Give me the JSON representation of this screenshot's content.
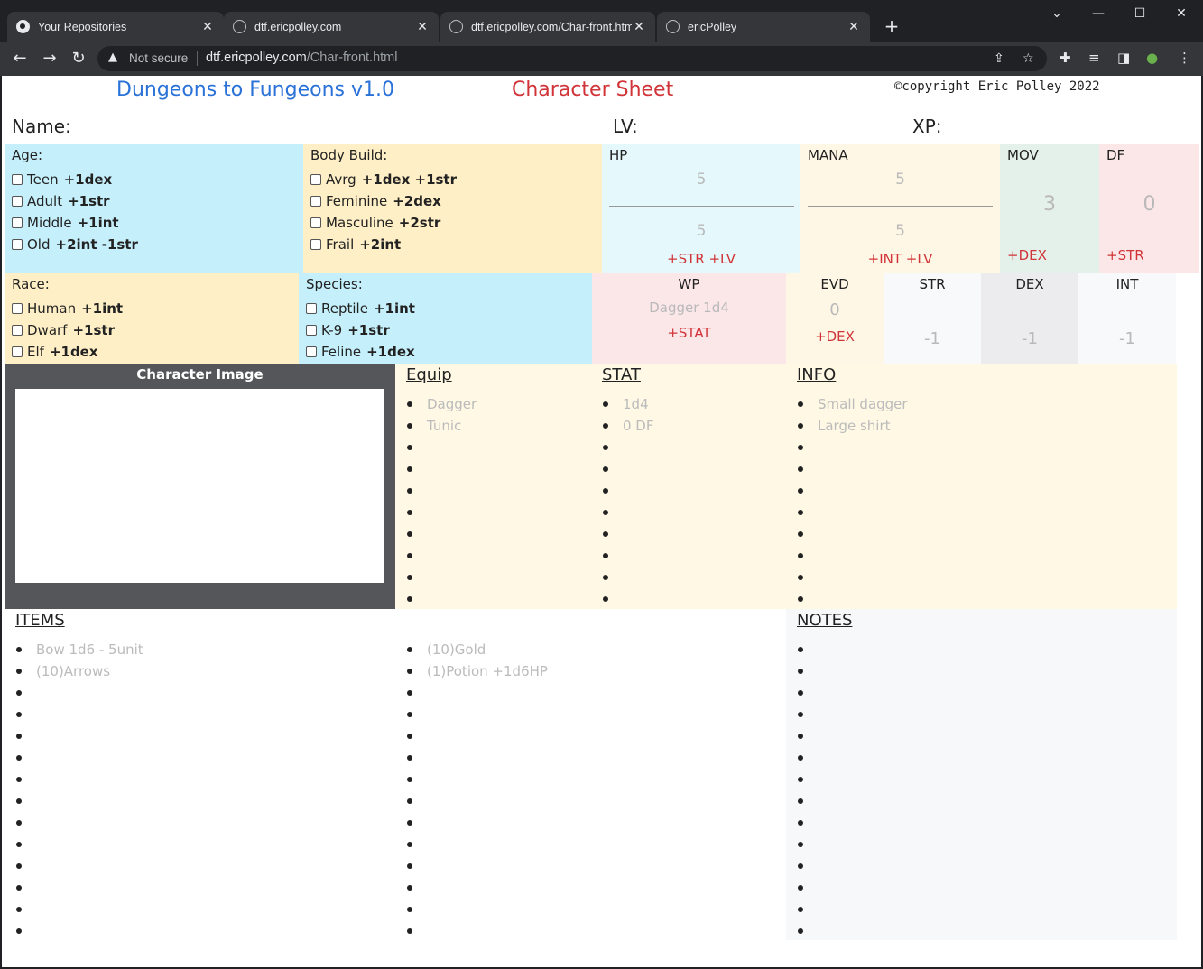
{
  "browser": {
    "tabs": [
      {
        "title": "Your Repositories",
        "icon": "github-icon"
      },
      {
        "title": "dtf.ericpolley.com",
        "icon": "globe-icon"
      },
      {
        "title": "dtf.ericpolley.com/Char-front.htm",
        "icon": "globe-icon"
      },
      {
        "title": "ericPolley",
        "icon": "globe-icon"
      }
    ],
    "not_secure": "Not secure",
    "url_host": "dtf.ericpolley.com",
    "url_path": "/Char-front.html"
  },
  "header": {
    "title": "Dungeons to Fungeons v1.0",
    "subtitle": "Character Sheet",
    "copyright": "©copyright Eric Polley 2022",
    "name_label": "Name:",
    "lv_label": "LV:",
    "xp_label": "XP:"
  },
  "age": {
    "label": "Age:",
    "options": [
      {
        "name": "Teen",
        "bonus": "+1dex"
      },
      {
        "name": "Adult",
        "bonus": "+1str"
      },
      {
        "name": "Middle",
        "bonus": "+1int"
      },
      {
        "name": "Old",
        "bonus": "+2int -1str"
      }
    ]
  },
  "body_build": {
    "label": "Body Build:",
    "options": [
      {
        "name": "Avrg",
        "bonus": "+1dex +1str"
      },
      {
        "name": "Feminine",
        "bonus": "+2dex"
      },
      {
        "name": "Masculine",
        "bonus": "+2str"
      },
      {
        "name": "Frail",
        "bonus": "+2int"
      }
    ]
  },
  "race": {
    "label": "Race:",
    "options": [
      {
        "name": "Human",
        "bonus": "+1int"
      },
      {
        "name": "Dwarf",
        "bonus": "+1str"
      },
      {
        "name": "Elf",
        "bonus": "+1dex"
      }
    ]
  },
  "species": {
    "label": "Species:",
    "options": [
      {
        "name": "Reptile",
        "bonus": "+1int"
      },
      {
        "name": "K-9",
        "bonus": "+1str"
      },
      {
        "name": "Feline",
        "bonus": "+1dex"
      }
    ]
  },
  "hp": {
    "label": "HP",
    "current": "5",
    "max": "5",
    "formula": "+STR +LV"
  },
  "mana": {
    "label": "MANA",
    "current": "5",
    "max": "5",
    "formula": "+INT +LV"
  },
  "mov": {
    "label": "MOV",
    "value": "3",
    "formula": "+DEX"
  },
  "df": {
    "label": "DF",
    "value": "0",
    "formula": "+STR"
  },
  "wp": {
    "label": "WP",
    "value": "Dagger 1d4",
    "formula": "+STAT"
  },
  "evd": {
    "label": "EVD",
    "value": "0",
    "formula": "+DEX"
  },
  "str": {
    "label": "STR",
    "value": "-1"
  },
  "dex": {
    "label": "DEX",
    "value": "-1"
  },
  "int": {
    "label": "INT",
    "value": "-1"
  },
  "character_image": {
    "label": "Character Image"
  },
  "equip": {
    "label": "Equip",
    "items": [
      "Dagger",
      "Tunic",
      "",
      "",
      "",
      "",
      "",
      "",
      "",
      ""
    ]
  },
  "stat": {
    "label": "STAT",
    "items": [
      "1d4",
      "0 DF",
      "",
      "",
      "",
      "",
      "",
      "",
      "",
      ""
    ]
  },
  "info": {
    "label": "INFO",
    "items": [
      "Small dagger",
      "Large shirt",
      "",
      "",
      "",
      "",
      "",
      "",
      "",
      ""
    ]
  },
  "items": {
    "label": "ITEMS",
    "col1": [
      "Bow 1d6 - 5unit",
      "(10)Arrows",
      "",
      "",
      "",
      "",
      "",
      "",
      "",
      "",
      "",
      "",
      "",
      ""
    ],
    "col2": [
      "(10)Gold",
      "(1)Potion +1d6HP",
      "",
      "",
      "",
      "",
      "",
      "",
      "",
      "",
      "",
      "",
      "",
      ""
    ]
  },
  "notes": {
    "label": "NOTES",
    "items": [
      "",
      "",
      "",
      "",
      "",
      "",
      "",
      "",
      "",
      "",
      "",
      "",
      "",
      ""
    ]
  }
}
